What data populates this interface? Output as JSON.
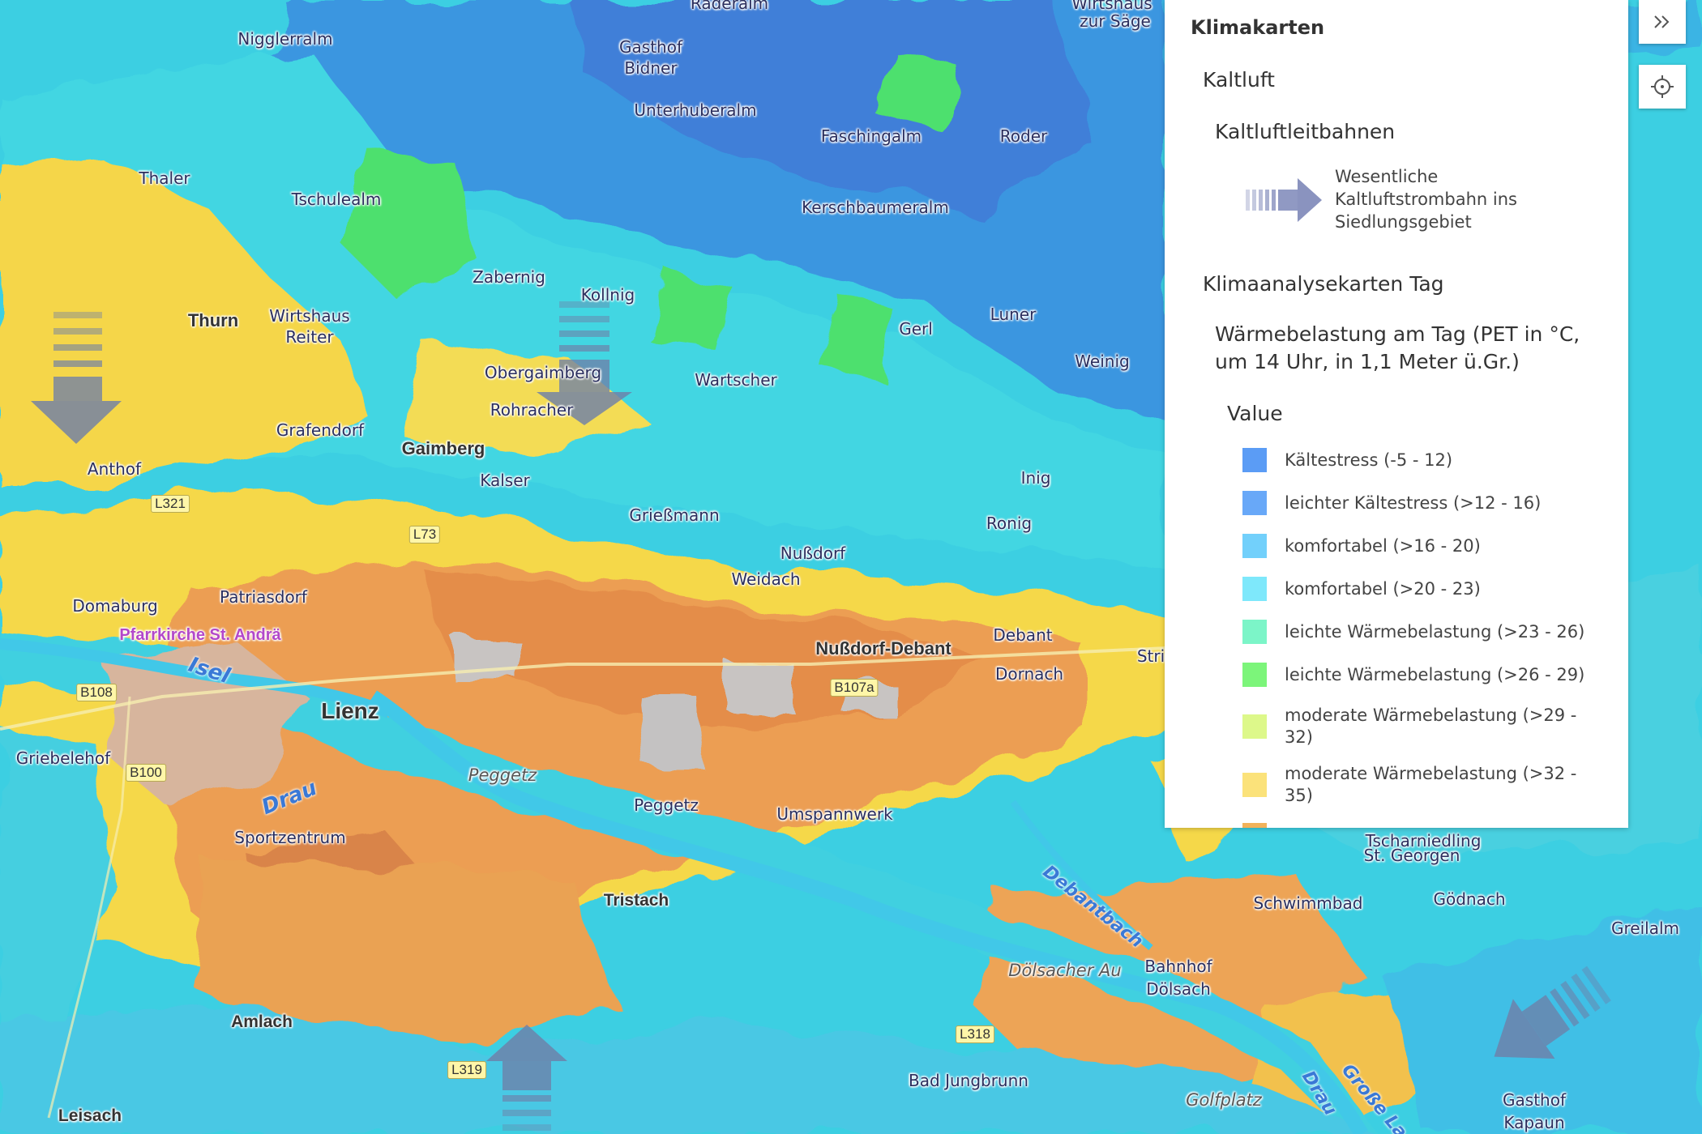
{
  "panel": {
    "title": "Klimakarten",
    "group_kaltluft": "Kaltluft",
    "layer_kaltluftleitbahnen": "Kaltluftleitbahnen",
    "kaltluft_legend_text": "Wesentliche Kaltluftstrombahn ins Siedlungsgebiet",
    "group_klimaanalyse": "Klimaanalysekarten Tag",
    "layer_pet": "Wärmebelastung am Tag (PET in °C, um 14 Uhr, in 1,1 Meter ü.Gr.)",
    "field_label": "Value",
    "legend": [
      {
        "label": "Kältestress (-5 - 12)",
        "color": "#5b9cf5"
      },
      {
        "label": "leichter Kältestress (>12 - 16)",
        "color": "#68a8f8"
      },
      {
        "label": "komfortabel (>16 - 20)",
        "color": "#72d0fb"
      },
      {
        "label": "komfortabel (>20 - 23)",
        "color": "#7ee8fb"
      },
      {
        "label": "leichte Wärmebelastung (>23 - 26)",
        "color": "#7cf5c8"
      },
      {
        "label": "leichte Wärmebelastung (>26 - 29)",
        "color": "#7cf57a"
      },
      {
        "label": "moderate Wärmebelastung (>29 - 32)",
        "color": "#ddf88a"
      },
      {
        "label": "moderate Wärmebelastung (>32 - 35)",
        "color": "#fbe27a"
      }
    ]
  },
  "buttons": {
    "collapse_icon": "double-chevron-right-icon",
    "locate_icon": "crosshair-icon"
  },
  "map": {
    "colors": {
      "cold": "#3b8fe0",
      "cool": "#36c5e6",
      "comfort": "#4ce0d8",
      "green": "#48e06a",
      "yellow": "#f5d84a",
      "orange": "#eea050",
      "dark_orange": "#de8a4a",
      "urban_gray": "#c8c4c2"
    },
    "labels": {
      "raderalm": "Raderalm",
      "wirtshaus_saege1": "Wirtshaus",
      "wirtshaus_saege2": "zur Säge",
      "nigglerralm": "Nigglerralm",
      "gasthof_bidner1": "Gasthof",
      "gasthof_bidner2": "Bidner",
      "unterhuberalm": "Unterhuberalm",
      "faschingalm": "Faschingalm",
      "roder": "Roder",
      "thaler": "Thaler",
      "tschulealm": "Tschulealm",
      "kerschbaumeralm": "Kerschbaumeralm",
      "zabernig": "Zabernig",
      "kollnig": "Kollnig",
      "thurn": "Thurn",
      "wirtshaus_reiter1": "Wirtshaus",
      "wirtshaus_reiter2": "Reiter",
      "gerl": "Gerl",
      "luner": "Luner",
      "weinig": "Weinig",
      "obergaimberg": "Obergaimberg",
      "wartscher": "Wartscher",
      "rohracher": "Rohracher",
      "grafendorf": "Grafendorf",
      "gaimberg": "Gaimberg",
      "anthof": "Anthof",
      "kalser": "Kalser",
      "inig": "Inig",
      "griessmann": "Grießmann",
      "ronig": "Ronig",
      "nussdorf": "Nußdorf",
      "weidach": "Weidach",
      "domaburg": "Domaburg",
      "patriasdorf": "Patriasdorf",
      "pfarrkirche": "Pfarrkirche St. Andrä",
      "debant": "Debant",
      "nussdorf_debant": "Nußdorf-Debant",
      "stri": "Stri",
      "isel": "Isel",
      "dornach": "Dornach",
      "lienz": "Lienz",
      "griebelehof": "Griebelehof",
      "peggetz_area": "Peggetz",
      "peggetz": "Peggetz",
      "drau": "Drau",
      "umspannwerk": "Umspannwerk",
      "sportzentrum": "Sportzentrum",
      "tscharniedling": "Tscharniedling",
      "st_georgen": "St. Georgen",
      "debantbach": "Debantbach",
      "schwimmbad": "Schwimmbad",
      "goednach": "Gödnach",
      "tristach": "Tristach",
      "greilalm": "Greilalm",
      "doelsacher_au": "Dölsacher Au",
      "bahnhof1": "Bahnhof",
      "bahnhof2": "Dölsach",
      "amlach": "Amlach",
      "bad_jungbrunn": "Bad Jungbrunn",
      "golfplatz": "Golfplatz",
      "drau2": "Drau",
      "grosse_la": "Große La",
      "leisach": "Leisach",
      "gasthof_kapaun1": "Gasthof",
      "gasthof_kapaun2": "Kapaun"
    },
    "roads": {
      "l321": "L321",
      "l73": "L73",
      "b108": "B108",
      "b100": "B100",
      "b107a": "B107a",
      "l318": "L318",
      "l319": "L319"
    }
  }
}
